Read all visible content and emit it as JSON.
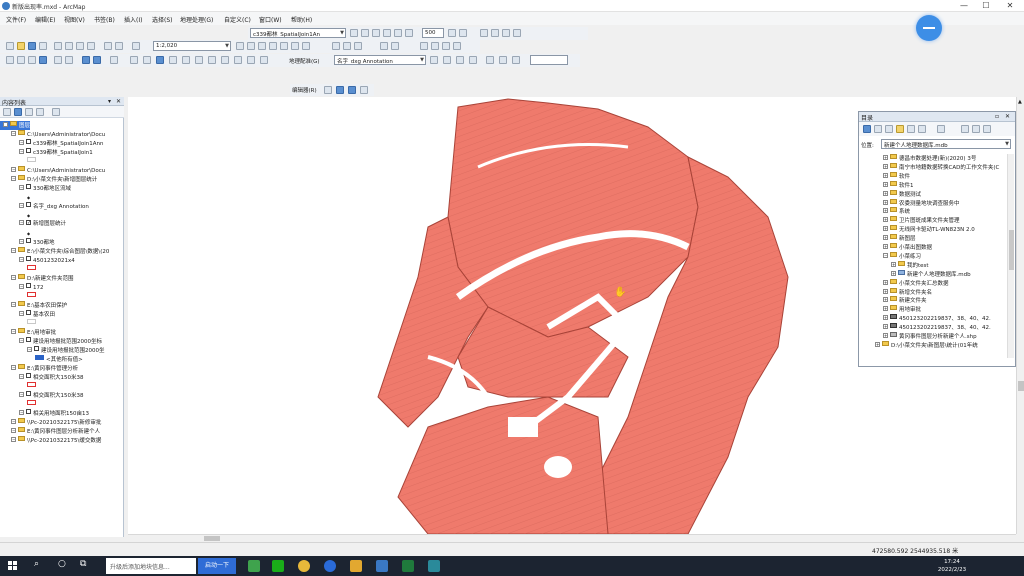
{
  "window": {
    "title": "新版出现率.mxd - ArcMap",
    "min": "—",
    "max": "☐",
    "close": "✕"
  },
  "menu": [
    "文件(F)",
    "编辑(E)",
    "视图(V)",
    "书签(B)",
    "插入(I)",
    "选择(S)",
    "地理处理(G)",
    "自定义(C)",
    "窗口(W)",
    "帮助(H)"
  ],
  "toolbar": {
    "layer_select": "c339都林_SpatialJoin1An",
    "scale": "1:2,020",
    "number_field": "500",
    "georef_label": "地理配准(G)",
    "target_layer": "名字_dxg Annotation",
    "editor_label": "编辑器(R)"
  },
  "toc": {
    "title": "内容列表",
    "close": "✕",
    "pin": "▾",
    "rows": [
      {
        "indent": 0,
        "type": "root",
        "text": "图层",
        "selected": true
      },
      {
        "indent": 1,
        "type": "folder",
        "text": "C:\\Users\\Administrator\\Docu"
      },
      {
        "indent": 2,
        "type": "check",
        "text": "c339都林_SpatialJoin1Ann"
      },
      {
        "indent": 2,
        "type": "check",
        "text": "c339都林_SpatialJoin1"
      },
      {
        "indent": 3,
        "type": "swatch",
        "color": "#c8c8c8",
        "text": ""
      },
      {
        "indent": 1,
        "type": "folder",
        "text": "C:\\Users\\Administrator\\Docu"
      },
      {
        "indent": 1,
        "type": "folder",
        "text": "D:\\小菜文件夹\\新增图层统计"
      },
      {
        "indent": 2,
        "type": "check",
        "text": "330都地区流域"
      },
      {
        "indent": 3,
        "type": "dot",
        "text": ""
      },
      {
        "indent": 2,
        "type": "check",
        "text": "名字_dxg Annotation"
      },
      {
        "indent": 3,
        "type": "dot",
        "text": ""
      },
      {
        "indent": 2,
        "type": "checked",
        "text": "新增图层统计"
      },
      {
        "indent": 3,
        "type": "dot",
        "text": ""
      },
      {
        "indent": 2,
        "type": "check",
        "text": "330都地"
      },
      {
        "indent": 1,
        "type": "folder",
        "text": "E:\\小菜文件夹\\综合图层\\数据\\(20"
      },
      {
        "indent": 2,
        "type": "check",
        "text": "4501232021x4"
      },
      {
        "indent": 3,
        "type": "swatch",
        "color": "#e03030",
        "text": ""
      },
      {
        "indent": 1,
        "type": "folder",
        "text": "D:\\新建文件夹范围"
      },
      {
        "indent": 2,
        "type": "check",
        "text": "172"
      },
      {
        "indent": 3,
        "type": "swatch",
        "color": "#e03030",
        "text": ""
      },
      {
        "indent": 1,
        "type": "folder",
        "text": "E:\\基本农田保护"
      },
      {
        "indent": 2,
        "type": "check",
        "text": "基本农田"
      },
      {
        "indent": 3,
        "type": "swatch",
        "color": "#c8c8c8",
        "text": ""
      },
      {
        "indent": 1,
        "type": "folder",
        "text": "E:\\用地审批"
      },
      {
        "indent": 2,
        "type": "check",
        "text": "建设用地报批范围2000坐标"
      },
      {
        "indent": 3,
        "type": "check",
        "text": "建设用地报批范围2000坐"
      },
      {
        "indent": 4,
        "type": "swatch-label",
        "color": "#2b63c6",
        "text": "<其他所有值>"
      },
      {
        "indent": 1,
        "type": "folder",
        "text": "E:\\黄冈事件管理分析"
      },
      {
        "indent": 2,
        "type": "check",
        "text": "相交面积大150米38"
      },
      {
        "indent": 3,
        "type": "swatch",
        "color": "#e03030",
        "text": ""
      },
      {
        "indent": 2,
        "type": "check",
        "text": "相交面积大150米38"
      },
      {
        "indent": 3,
        "type": "swatch",
        "color": "#e03030",
        "text": ""
      },
      {
        "indent": 2,
        "type": "check",
        "text": "相关用地面积150亩13"
      },
      {
        "indent": 1,
        "type": "folder",
        "text": "\\\\Pc-20210322175\\新修审批"
      },
      {
        "indent": 1,
        "type": "folder",
        "text": "E:\\黄冈事件图层分析新建个人"
      },
      {
        "indent": 1,
        "type": "folder",
        "text": "\\\\Pc-20210322175\\缓交数据"
      }
    ]
  },
  "catalog": {
    "title": "目录",
    "location_label": "位置:",
    "location_value": "新建个人地理数据库.mdb",
    "rows": [
      {
        "indent": 0,
        "icon": "folder",
        "text": "德昌市数据处理(新)(2020) 3号"
      },
      {
        "indent": 0,
        "icon": "folder",
        "text": "南宁市地籍数据转换CAD的工作文件夹(C"
      },
      {
        "indent": 0,
        "icon": "folder",
        "text": "软件"
      },
      {
        "indent": 0,
        "icon": "folder",
        "text": "软件1"
      },
      {
        "indent": 0,
        "icon": "folder",
        "text": "数据测试"
      },
      {
        "indent": 0,
        "icon": "folder",
        "text": "农委测量地块调查服务中"
      },
      {
        "indent": 0,
        "icon": "folder",
        "text": "系统"
      },
      {
        "indent": 0,
        "icon": "folder",
        "text": "卫片图斑成果文件夹管理"
      },
      {
        "indent": 0,
        "icon": "folder",
        "text": "无线网卡驱动TL-WN823N 2.0"
      },
      {
        "indent": 0,
        "icon": "folder",
        "text": "新图层"
      },
      {
        "indent": 0,
        "icon": "folder",
        "text": "小菜出图数据"
      },
      {
        "indent": 0,
        "icon": "folder",
        "text": "小菜练习",
        "expanded": true
      },
      {
        "indent": 1,
        "icon": "folder",
        "text": "我的test"
      },
      {
        "indent": 1,
        "icon": "db",
        "text": "新建个人地理数据库.mdb"
      },
      {
        "indent": 0,
        "icon": "folder",
        "text": "小菜文件夹汇总数据"
      },
      {
        "indent": 0,
        "icon": "folder",
        "text": "新增文件夹名"
      },
      {
        "indent": 0,
        "icon": "folder",
        "text": "新建文件夹"
      },
      {
        "indent": 0,
        "icon": "folder",
        "text": "用地审批"
      },
      {
        "indent": 0,
        "icon": "grid",
        "text": "450123202219837、38、40、42."
      },
      {
        "indent": 0,
        "icon": "grid",
        "text": "450123202219837、38、40、42."
      },
      {
        "indent": 0,
        "icon": "file",
        "text": "黄冈事件图层分析新建个人.shp"
      },
      {
        "indent": -1,
        "icon": "folder",
        "text": "D:\\小菜文件夹\\新图层\\统计(01年统"
      }
    ]
  },
  "status": {
    "coords": "472580.592  2544935.518 米"
  },
  "taskbar": {
    "search_text": "升级后添加地块信息...",
    "button": "启动一下",
    "time": "17:24",
    "date": "2022/2/23"
  },
  "colors": {
    "parcel": "#ef7a6c",
    "parcel_line": "#b04a40",
    "accent": "#2f6cd6"
  }
}
